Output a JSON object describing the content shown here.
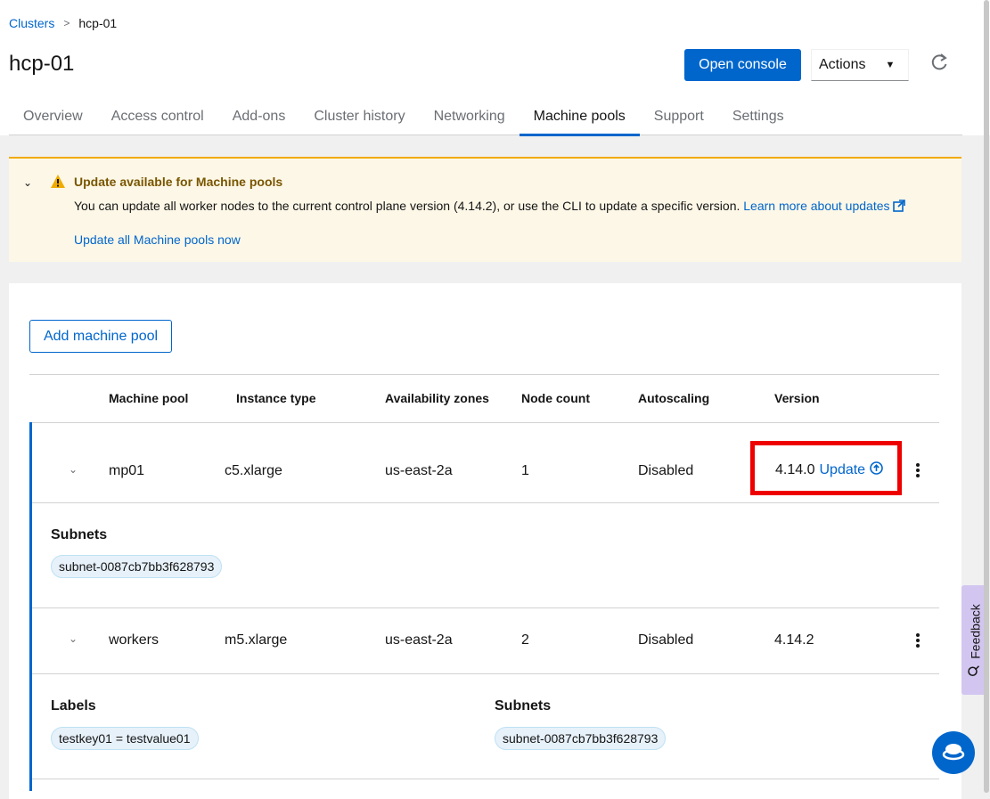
{
  "breadcrumb": {
    "parent": "Clusters",
    "separator": ">",
    "current": "hcp-01"
  },
  "page": {
    "title": "hcp-01"
  },
  "header": {
    "open_console": "Open console",
    "actions": "Actions",
    "refresh_icon": "refresh-icon"
  },
  "tabs": [
    {
      "label": "Overview"
    },
    {
      "label": "Access control"
    },
    {
      "label": "Add-ons"
    },
    {
      "label": "Cluster history"
    },
    {
      "label": "Networking"
    },
    {
      "label": "Machine pools",
      "active": true
    },
    {
      "label": "Support"
    },
    {
      "label": "Settings"
    }
  ],
  "alert": {
    "title": "Update available for Machine pools",
    "body": "You can update all worker nodes to the current control plane version (4.14.2), or use the CLI to update a specific version.",
    "link": "Learn more about updates",
    "action": "Update all Machine pools now",
    "color": "#f0ab00"
  },
  "machine_pools": {
    "add_button": "Add machine pool",
    "columns": [
      "Machine pool",
      "Instance type",
      "Availability zones",
      "Node count",
      "Autoscaling",
      "Version"
    ],
    "rows": [
      {
        "name": "mp01",
        "instance_type": "c5.xlarge",
        "zones": "us-east-2a",
        "node_count": "1",
        "autoscaling": "Disabled",
        "version": "4.14.0",
        "update_link": "Update",
        "details": {
          "subnets_label": "Subnets",
          "subnets": [
            "subnet-0087cb7bb3f628793"
          ]
        }
      },
      {
        "name": "workers",
        "instance_type": "m5.xlarge",
        "zones": "us-east-2a",
        "node_count": "2",
        "autoscaling": "Disabled",
        "version": "4.14.2",
        "details": {
          "labels_label": "Labels",
          "labels": [
            "testkey01 = testvalue01"
          ],
          "subnets_label": "Subnets",
          "subnets": [
            "subnet-0087cb7bb3f628793"
          ]
        }
      }
    ]
  },
  "feedback": {
    "label": "Feedback"
  },
  "colors": {
    "primary": "#0066cc",
    "highlight": "#ee0000"
  }
}
